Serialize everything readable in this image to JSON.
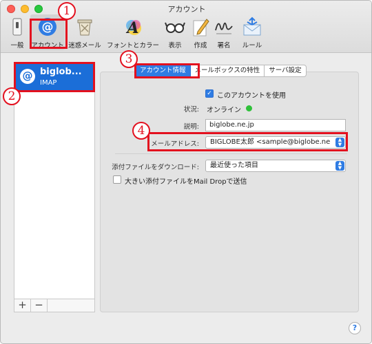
{
  "window": {
    "title": "アカウント"
  },
  "toolbar": {
    "items": [
      {
        "label": "一般",
        "icon": "switch-icon"
      },
      {
        "label": "アカウント",
        "icon": "at-icon"
      },
      {
        "label": "迷惑メール",
        "icon": "trash-icon"
      },
      {
        "label": "フォントとカラー",
        "icon": "font-icon"
      },
      {
        "label": "表示",
        "icon": "glasses-icon"
      },
      {
        "label": "作成",
        "icon": "pencil-icon"
      },
      {
        "label": "署名",
        "icon": "signature-icon"
      },
      {
        "label": "ルール",
        "icon": "rules-icon"
      }
    ]
  },
  "sidebar": {
    "account": {
      "icon": "at-icon",
      "name": "biglob...",
      "type": "IMAP"
    },
    "add_label": "+",
    "remove_label": "−"
  },
  "tabs": [
    "アカウント情報",
    "メールボックスの特性",
    "サーバ設定"
  ],
  "form": {
    "enable_label": "このアカウントを使用",
    "enable_checked": true,
    "status_label": "状況:",
    "status_value": "オンライン",
    "status_color": "#2fc13a",
    "description_label": "説明:",
    "description_value": "biglobe.ne.jp",
    "email_label": "メールアドレス:",
    "email_value": "BIGLOBE太郎 <sample@biglobe.ne",
    "download_label": "添付ファイルをダウンロード:",
    "download_value": "最近使った項目",
    "maildrop_label": "大きい添付ファイルをMail Dropで送信",
    "maildrop_checked": false
  },
  "help_label": "?",
  "callouts": [
    "1",
    "2",
    "3",
    "4"
  ],
  "colors": {
    "accent": "#2f7ce3",
    "callout": "#e3101e",
    "selection": "#1b6ed8"
  }
}
